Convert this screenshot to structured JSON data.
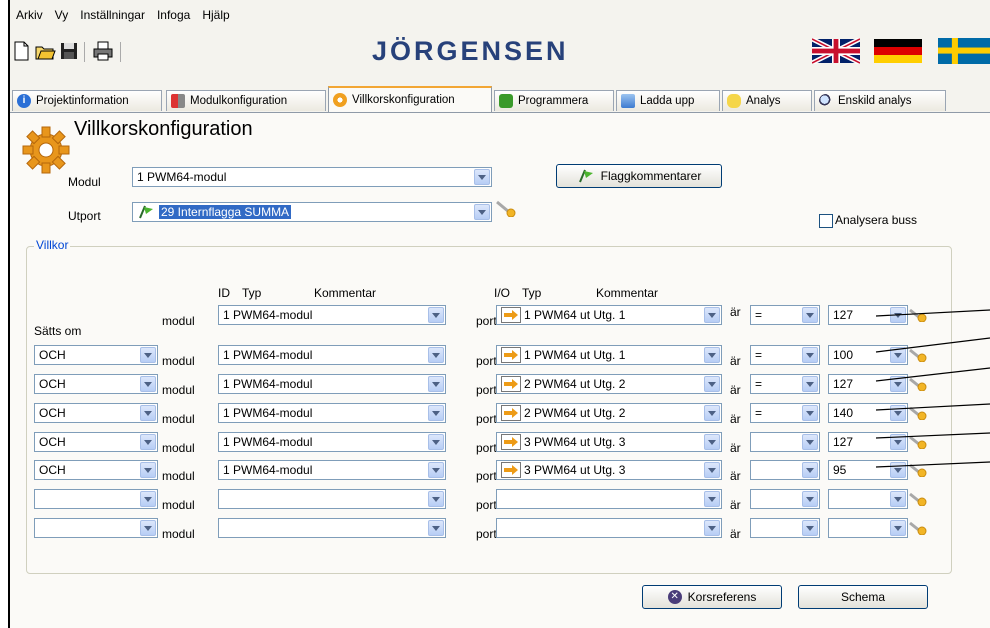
{
  "menu": [
    "Arkiv",
    "Vy",
    "Inställningar",
    "Infoga",
    "Hjälp"
  ],
  "logo": "JÖRGENSEN",
  "tabs": [
    {
      "label": "Projektinformation",
      "icon": "info-icon"
    },
    {
      "label": "Modulkonfiguration",
      "icon": "tools-icon"
    },
    {
      "label": "Villkorskonfiguration",
      "icon": "gear-icon",
      "active": true
    },
    {
      "label": "Programmera",
      "icon": "arrow-down-icon"
    },
    {
      "label": "Ladda upp",
      "icon": "arrow-up-icon"
    },
    {
      "label": "Analys",
      "icon": "io-icon"
    },
    {
      "label": "Enskild analys",
      "icon": "magnifier-icon"
    }
  ],
  "page": {
    "title": "Villkorskonfiguration",
    "modul_label": "Modul",
    "modul_value": "1 PWM64-modul",
    "utport_label": "Utport",
    "utport_value": "29 Internflagga SUMMA",
    "flag_button": "Flaggkommentarer",
    "analyze_bus": "Analysera buss"
  },
  "conditions": {
    "legend": "Villkor",
    "headers": {
      "id": "ID",
      "type": "Typ",
      "comment": "Kommentar",
      "io": "I/O",
      "io_type": "Typ",
      "io_comment": "Kommentar",
      "set_if": "Sätts om"
    },
    "rows": [
      {
        "logic": "",
        "module_word": "modul",
        "module": "1 PWM64-modul",
        "port_word": "port",
        "port": "1 PWM64 ut Utg. 1",
        "is_word": "är",
        "op": "=",
        "value": "127"
      },
      {
        "logic": "OCH",
        "module_word": "modul",
        "module": "1 PWM64-modul",
        "port_word": "port",
        "port": "1 PWM64 ut Utg. 1",
        "is_word": "är",
        "op": "=",
        "value": "100"
      },
      {
        "logic": "OCH",
        "module_word": "modul",
        "module": "1 PWM64-modul",
        "port_word": "port",
        "port": "2 PWM64 ut Utg. 2",
        "is_word": "är",
        "op": "=",
        "value": "127"
      },
      {
        "logic": "OCH",
        "module_word": "modul",
        "module": "1 PWM64-modul",
        "port_word": "port",
        "port": "2 PWM64 ut Utg. 2",
        "is_word": "är",
        "op": "=",
        "value": "140"
      },
      {
        "logic": "OCH",
        "module_word": "modul",
        "module": "1 PWM64-modul",
        "port_word": "port",
        "port": "3 PWM64 ut Utg. 3",
        "is_word": "är",
        "op": "",
        "value": "127"
      },
      {
        "logic": "OCH",
        "module_word": "modul",
        "module": "1 PWM64-modul",
        "port_word": "port",
        "port": "3 PWM64 ut Utg. 3",
        "is_word": "är",
        "op": "",
        "value": "95"
      },
      {
        "logic": "",
        "module_word": "modul",
        "module": "",
        "port_word": "port",
        "port": "",
        "is_word": "är",
        "op": "",
        "value": ""
      },
      {
        "logic": "",
        "module_word": "modul",
        "module": "",
        "port_word": "port",
        "port": "",
        "is_word": "är",
        "op": "",
        "value": ""
      }
    ]
  },
  "footer": {
    "xref": "Korsreferens",
    "schema": "Schema"
  },
  "colors": {
    "logo": "#27417a",
    "tab_active_accent": "#f2a634",
    "combo_border": "#7f9db9",
    "selection": "#316ac5",
    "legend": "#0046d5"
  }
}
